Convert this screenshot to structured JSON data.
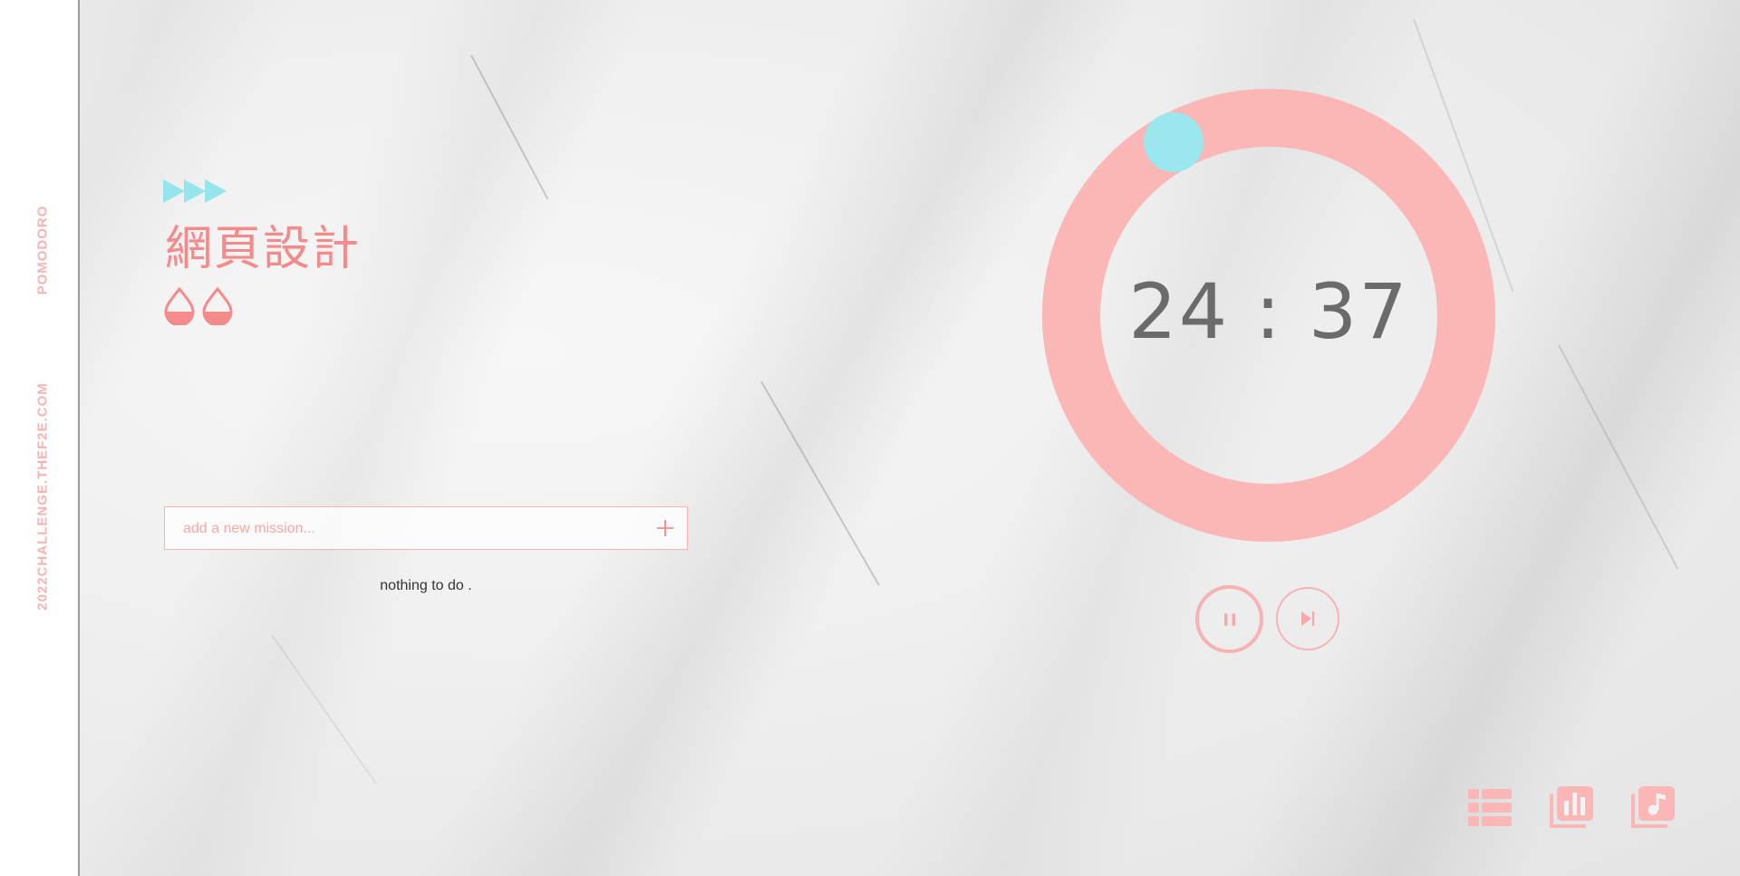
{
  "sidebar": {
    "brand": "POMODORO",
    "site": "2022CHALLENGE.THEF2E.COM"
  },
  "mission": {
    "title": "網頁設計",
    "arrow_icon": "triple-play-arrow-icon",
    "pomodoro_icon": "drop-icon"
  },
  "todo": {
    "placeholder": "add a new mission...",
    "add_icon": "plus-icon",
    "empty_text": "nothing to do ."
  },
  "timer": {
    "display": "24 : 37",
    "progress": 0.92
  },
  "controls": {
    "pause_icon": "pause-icon",
    "skip_icon": "skip-next-icon"
  },
  "nav": {
    "list_icon": "list-icon",
    "chart_icon": "chart-icon",
    "music_icon": "music-icon"
  },
  "colors": {
    "accent_pink": "#f7b3b3",
    "text_pink": "#f48a8a",
    "accent_cyan": "#94e6ec",
    "timer_text": "#6b6b6b"
  }
}
